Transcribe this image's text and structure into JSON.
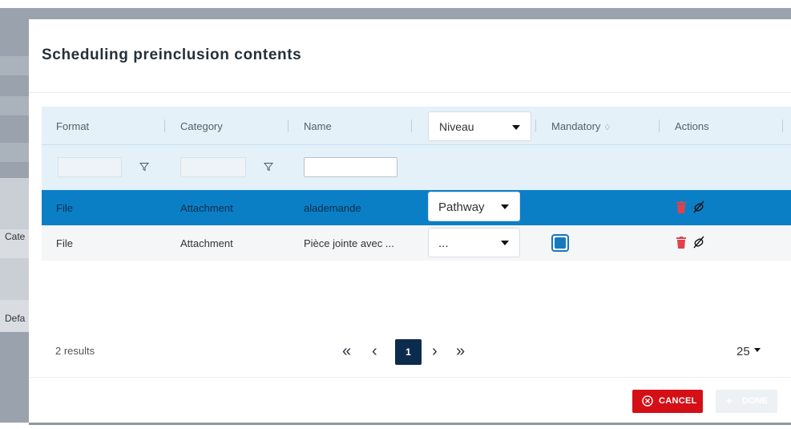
{
  "background": {
    "left_labels": [
      "Cate",
      "Defa"
    ]
  },
  "modal": {
    "title": "Scheduling preinclusion contents",
    "table": {
      "columns": {
        "format": "Format",
        "category": "Category",
        "name": "Name",
        "niveau": "Niveau",
        "mandatory": "Mandatory",
        "actions": "Actions"
      },
      "filters": {
        "format_value": "",
        "category_value": "",
        "name_value": ""
      },
      "rows": [
        {
          "format": "File",
          "category": "Attachment",
          "name": "alademande",
          "niveau": "Pathway",
          "mandatory": false,
          "selected": true
        },
        {
          "format": "File",
          "category": "Attachment",
          "name": "Pièce jointe avec ...",
          "niveau": "...",
          "mandatory": true,
          "selected": false
        }
      ]
    },
    "footer": {
      "results": "2 results",
      "current_page": "1",
      "page_size": "25"
    },
    "buttons": {
      "cancel": "CANCEL",
      "done": "DONE"
    }
  },
  "colors": {
    "header_bg": "#e4f1f9",
    "selected_row": "#0b7fc6",
    "pager_active": "#0d2c4d",
    "cancel": "#d50f16",
    "trash": "#e0424b",
    "checkbox": "#1479bf"
  },
  "icons": [
    "funnel-icon",
    "sort-icon",
    "trash-icon",
    "unlink-icon",
    "first-page-icon",
    "prev-page-icon",
    "next-page-icon",
    "last-page-icon",
    "cancel-circle-icon",
    "plus-icon",
    "caret-down-icon"
  ]
}
